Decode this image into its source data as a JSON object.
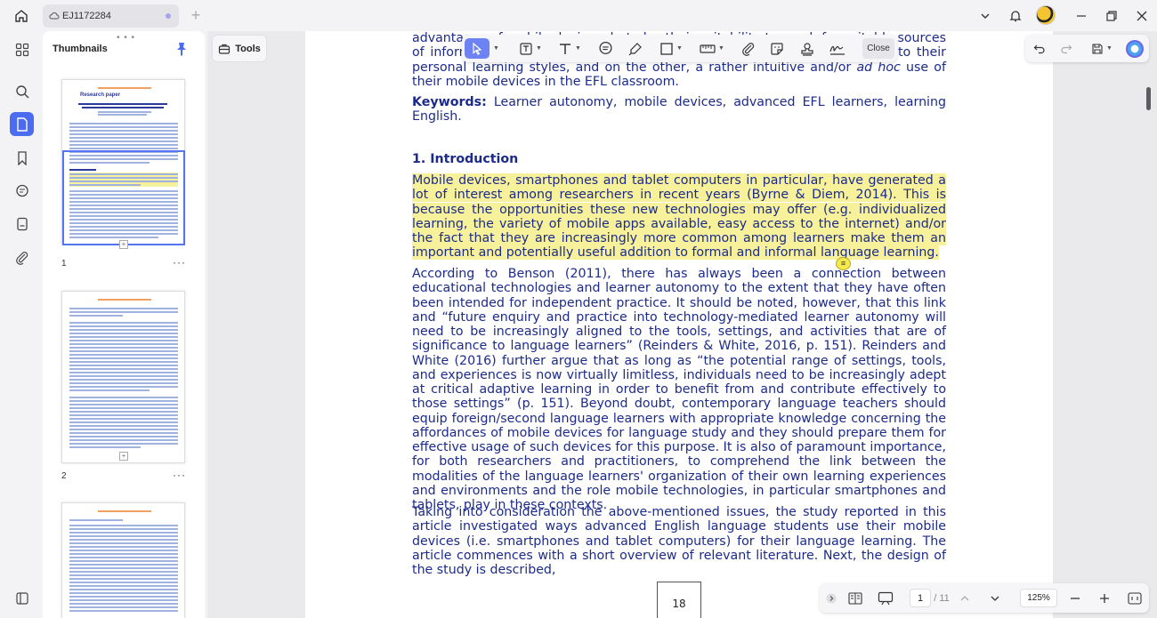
{
  "titlebar": {
    "tab_title": "EJ1172284"
  },
  "thumbnails": {
    "title": "Thumbnails",
    "pages": [
      {
        "num": "1",
        "more": "···"
      },
      {
        "num": "2",
        "more": "···"
      }
    ],
    "page1_title": "Research paper"
  },
  "toolbar": {
    "tools_label": "Tools",
    "close_label": "Close"
  },
  "document": {
    "p_top": "advantages of mobile devices, but also their suitability to reach for suitable sources of information and, meet their needs and adjust their learning of English to their personal learning styles, and on the other, a rather intuitive and/or",
    "p_top_italic": "ad hoc",
    "p_top_end": "use of their mobile devices in the EFL classroom.",
    "keywords_label": "Keywords:",
    "keywords_text": "Learner autonomy, mobile devices, advanced EFL learners, learning English.",
    "section_heading": "1. Introduction",
    "p1": "Mobile devices, smartphones and tablet computers in particular, have generated a lot of interest among researchers in recent years (Byrne & Diem, 2014). This is because the opportunities these new technologies may offer (e.g. individualized learning, the variety of mobile apps available, easy access to the internet) and/or the fact that they are increasingly more common among learners make them an important and potentially useful addition to formal and informal language learning.",
    "p2": "According to Benson (2011), there has always been a connection between educational technologies and learner autonomy to the extent that they have often been intended for independent practice. It should be noted, however, that this link and “future enquiry and practice into technology-mediated learner autonomy will need to be increasingly aligned to the tools, settings, and activities that are of significance to language learners” (Reinders & White, 2016, p. 151). Reinders and White (2016) further argue that as long as “the potential range of settings, tools, and experiences is now virtually limitless, individuals need to be increasingly adept at critical adaptive learning in order to benefit from and contribute effectively to those settings” (p. 151). Beyond doubt, contemporary language teachers should equip foreign/second language learners with appropriate knowledge concerning the affordances of mobile devices for language study and they should prepare them for effective usage of such devices for this purpose. It is also of paramount importance, for both researchers and practitioners, to comprehend the link between the modalities of the language learners' organization of their own learning experiences and environments and the role mobile technologies, in particular smartphones and tablets, play in these contexts.",
    "p3": "Taking into consideration the above-mentioned issues, the study reported in this article investigated ways advanced English language students use their mobile devices (i.e. smartphones and tablet computers) for their language learning. The article commences with a short overview of relevant literature. Next, the design of the study is described,",
    "page_number": "18",
    "comment_glyph": "≡"
  },
  "bottombar": {
    "current_page": "1",
    "total_pages": "/ 11",
    "zoom": "125%"
  },
  "colors": {
    "accent": "#4b6cf0",
    "highlight": "#f7f19b",
    "doc_text": "#1c2b8a"
  }
}
